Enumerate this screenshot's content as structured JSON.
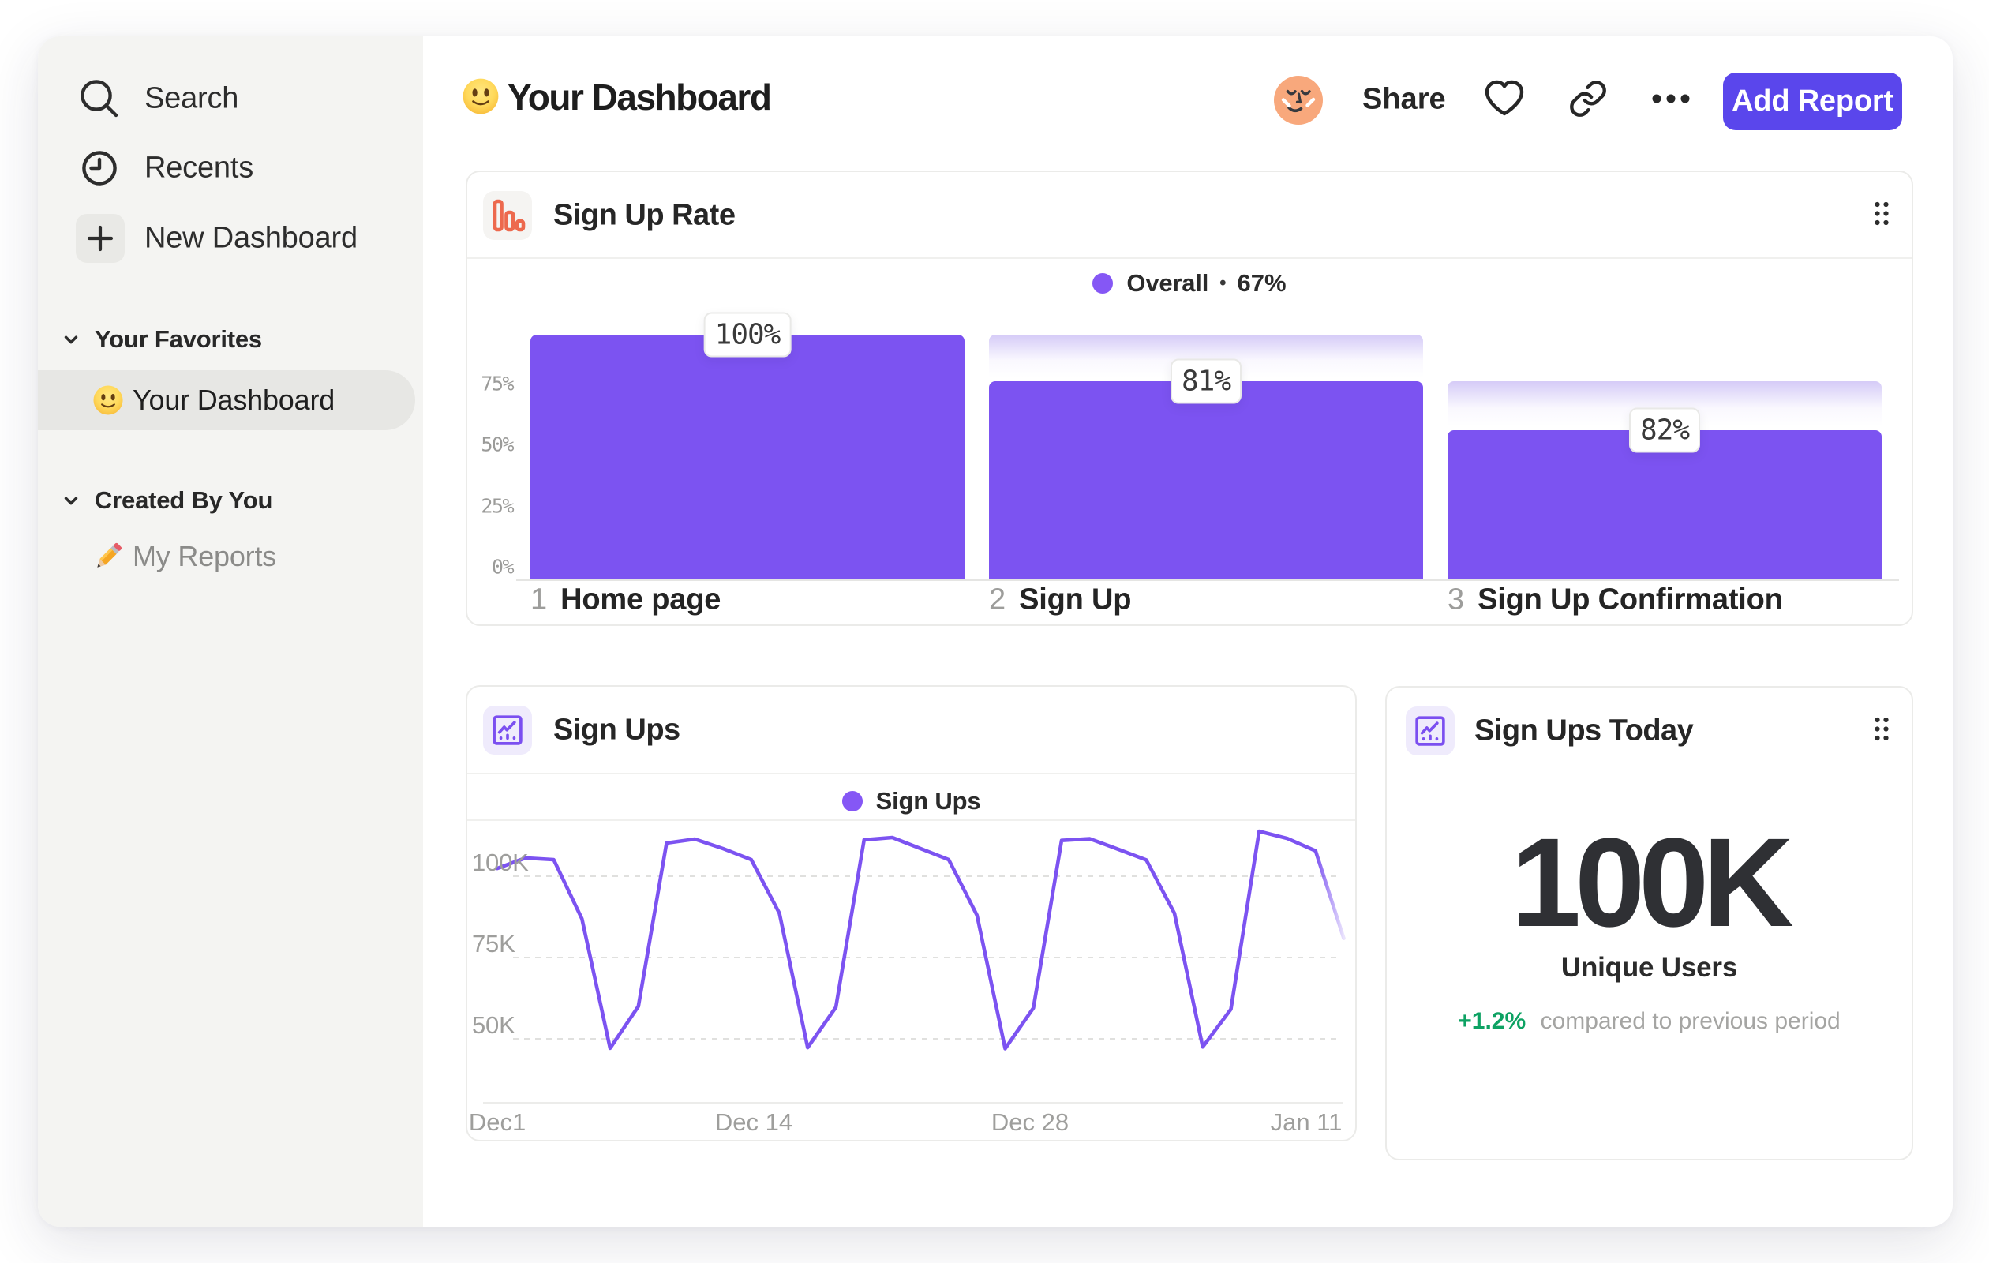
{
  "colors": {
    "accent_purple": "#7C53F1",
    "legend_dot_purple": "#8557F5",
    "button_purple": "#5A46EC",
    "ghost_purple": "#D5CBF7",
    "icon_orange": "#ED694E",
    "icon_purple": "#7B4FF0",
    "positive_green": "#0DA263",
    "sidebar_bg": "#F4F4F2",
    "muted_gray": "#9B9B99"
  },
  "sidebar": {
    "nav": [
      {
        "label": "Search",
        "icon": "search-icon"
      },
      {
        "label": "Recents",
        "icon": "clock-icon"
      },
      {
        "label": "New Dashboard",
        "icon": "plus-icon"
      }
    ],
    "sections": [
      {
        "title": "Your Favorites",
        "items": [
          {
            "label": "Your Dashboard",
            "emoji": "smiley",
            "selected": true
          }
        ]
      },
      {
        "title": "Created By You",
        "items": [
          {
            "label": "My Reports",
            "emoji": "pencil",
            "selected": false
          }
        ]
      }
    ]
  },
  "header": {
    "emoji": "smiley",
    "title": "Your Dashboard",
    "share_label": "Share",
    "add_report_label": "Add Report"
  },
  "funnel_card": {
    "title": "Sign Up Rate",
    "icon": "bar-chart-icon"
  },
  "line_card": {
    "title": "Sign Ups",
    "icon": "line-chart-icon"
  },
  "today_card": {
    "title": "Sign Ups Today",
    "icon": "line-chart-icon",
    "value": "100K",
    "subtitle": "Unique Users",
    "delta": "+1.2%",
    "delta_note": "compared to previous period"
  },
  "chart_data": [
    {
      "id": "signup_rate_funnel",
      "type": "bar",
      "title": "Sign Up Rate",
      "legend": {
        "name": "Overall",
        "sep": "•",
        "value": "67%"
      },
      "legend_position": "top-center",
      "grid": false,
      "ylabel": "",
      "xlabel": "",
      "ylim": [
        0,
        107
      ],
      "yticks": [
        "75%",
        "50%",
        "25%",
        "0%"
      ],
      "ytick_values": [
        75,
        50,
        25,
        0
      ],
      "categories": [
        "Home page",
        "Sign Up",
        "Sign Up Confirmation"
      ],
      "step_numbers": [
        "1",
        "2",
        "3"
      ],
      "conversion_labels": [
        "100%",
        "81%",
        "82%"
      ],
      "bar_heights_pct_of_first": [
        100,
        81,
        61
      ],
      "ghost_heights_pct_of_first": [
        null,
        100,
        81
      ]
    },
    {
      "id": "signups_line",
      "type": "line",
      "title": "Sign Ups",
      "legend": {
        "name": "Sign Ups"
      },
      "legend_position": "top-center",
      "grid": true,
      "gridstyle": "dashed",
      "xlabel": "",
      "ylabel": "",
      "x_tick_labels": [
        "Dec1",
        "Dec 14",
        "Dec 28",
        "Jan 11"
      ],
      "x_tick_days": [
        0,
        13,
        27,
        41
      ],
      "yticks": [
        "100K",
        "75K",
        "50K"
      ],
      "ytick_values": [
        100,
        75,
        50
      ],
      "ylim": [
        30.5,
        117.5
      ],
      "x_day_span": 43,
      "point_interval_days": 1.43,
      "values_thousands": [
        102.4,
        105.6,
        105.1,
        86.9,
        47.1,
        60.0,
        110.2,
        111.4,
        108.5,
        105.1,
        88.6,
        47.3,
        59.7,
        111.2,
        111.9,
        108.5,
        105.1,
        88.0,
        47.0,
        59.5,
        111.0,
        111.5,
        108.3,
        105.0,
        88.6,
        47.5,
        59.1,
        113.8,
        111.6,
        107.8,
        80.9
      ],
      "fade_from_index": 29
    },
    {
      "id": "signups_today_metric",
      "type": "metric",
      "title": "Sign Ups Today",
      "value": 100000,
      "value_display": "100K",
      "unit": "Unique Users",
      "change_pct": 1.2,
      "change_display": "+1.2%",
      "comparison": "compared to previous period"
    }
  ]
}
